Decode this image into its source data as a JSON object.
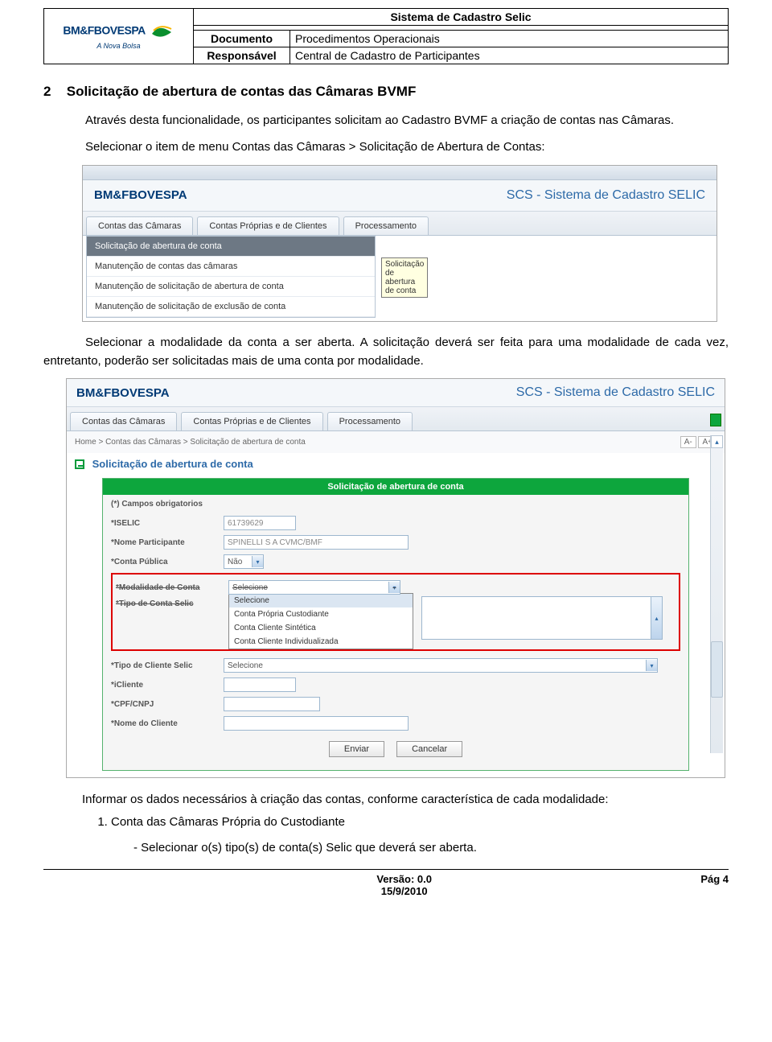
{
  "header": {
    "title": "Sistema de Cadastro Selic",
    "logo_main": "BM&FBOVESPA",
    "logo_sub": "A Nova Bolsa",
    "row1_label": "Documento",
    "row1_value": "Procedimentos Operacionais",
    "row2_label": "Responsável",
    "row2_value": "Central de Cadastro de Participantes"
  },
  "section": {
    "number": "2",
    "title": "Solicitação de abertura de contas das Câmaras BVMF"
  },
  "p1": "Através desta funcionalidade, os participantes solicitam ao Cadastro BVMF a criação de contas nas Câmaras.",
  "p2": "Selecionar o item de menu Contas das Câmaras > Solicitação de Abertura de Contas:",
  "p3": "Selecionar a modalidade da conta a ser aberta. A solicitação deverá ser feita para uma modalidade de cada vez, entretanto, poderão ser solicitadas mais de uma conta por modalidade.",
  "post1": "Informar os dados necessários à criação das contas, conforme característica de cada modalidade:",
  "li1": "Conta das Câmaras Própria do Custodiante",
  "li1_sub": "- Selecionar o(s) tipo(s) de conta(s) Selic que deverá ser aberta.",
  "screenshot_common": {
    "logo": "BM&FBOVESPA",
    "sysname": "SCS - Sistema de Cadastro SELIC",
    "tabs": [
      "Contas das Câmaras",
      "Contas Próprias e de Clientes",
      "Processamento"
    ]
  },
  "shot1": {
    "menu": [
      "Solicitação de abertura de conta",
      "Manutenção de contas das câmaras",
      "Manutenção de solicitação de abertura de conta",
      "Manutenção de solicitação de exclusão de conta"
    ],
    "tooltip": "Solicitação de abertura de conta"
  },
  "shot2": {
    "breadcrumb": "Home > Contas das Câmaras > Solicitação de abertura de conta",
    "font_minus": "A-",
    "font_plus": "A+",
    "page_title": "Solicitação de abertura de conta",
    "form_header": "Solicitação de abertura de conta",
    "mandatory_note": "(*) Campos obrigatorios",
    "labels": {
      "iselic": "*ISELIC",
      "nomepart": "*Nome Participante",
      "contapub": "*Conta Pública",
      "modalidade": "*Modalidade de Conta",
      "tiposelic": "*Tipo de Conta Selic",
      "tipocliente": "*Tipo de Cliente Selic",
      "icliente": "*iCliente",
      "cpfcnpj": "*CPF/CNPJ",
      "nomecliente": "*Nome do Cliente"
    },
    "values": {
      "iselic": "61739629",
      "nomepart": "SPINELLI S A CVMC/BMF",
      "contapub": "Não",
      "mod_sel": "Selecione",
      "tiposelic_sel": "",
      "tipocliente_sel": "Selecione"
    },
    "dropdown_options": [
      "Selecione",
      "Conta Própria Custodiante",
      "Conta Cliente Sintética",
      "Conta Cliente Individualizada"
    ],
    "btn_submit": "Enviar",
    "btn_cancel": "Cancelar"
  },
  "footer": {
    "version_label": "Versão: 0.0",
    "date": "15/9/2010",
    "page": "Pág 4"
  }
}
